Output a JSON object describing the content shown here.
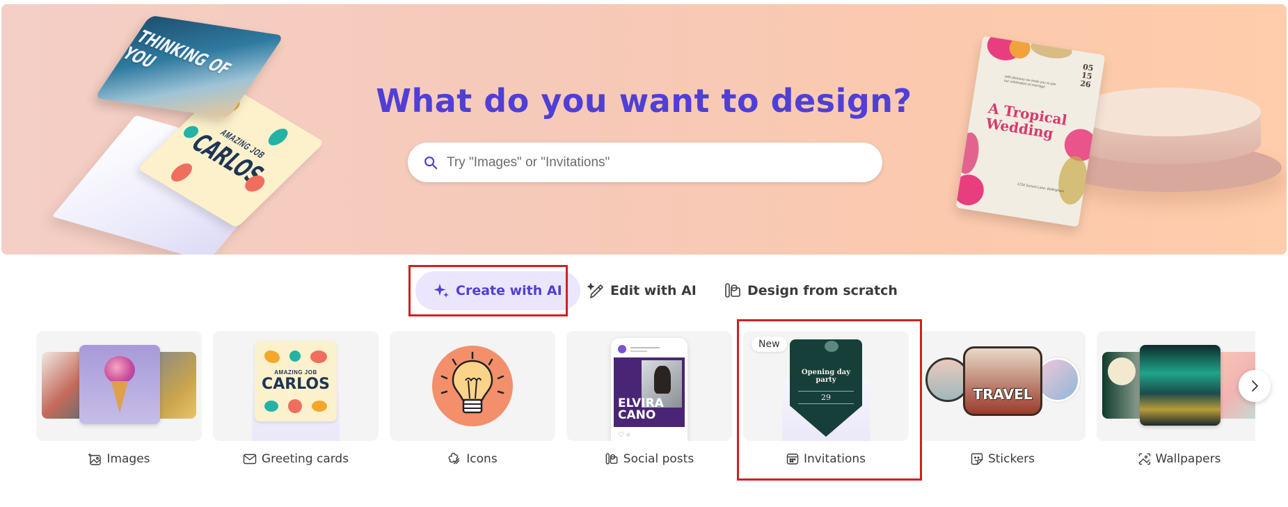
{
  "hero": {
    "title": "What do you want to design?",
    "search_placeholder": "Try \"Images\" or \"Invitations\"",
    "search_icon": "search-icon",
    "left_art": {
      "card_top_text": "THINKING OF YOU",
      "card_bottom_small": "AMAZING JOB",
      "card_bottom_big": "CARLOS"
    },
    "right_art": {
      "card_title": "A Tropical Wedding",
      "card_date": [
        "05",
        "15",
        "26"
      ]
    }
  },
  "modes": [
    {
      "label": "Create with AI",
      "icon": "sparkle-icon",
      "active": true
    },
    {
      "label": "Edit with AI",
      "icon": "magic-pen-icon",
      "active": false
    },
    {
      "label": "Design from scratch",
      "icon": "shapes-icon",
      "active": false
    }
  ],
  "categories": [
    {
      "label": "Images",
      "icon": "ai-image-icon"
    },
    {
      "label": "Greeting cards",
      "icon": "envelope-icon",
      "thumb_small": "AMAZING JOB",
      "thumb_big": "CARLOS"
    },
    {
      "label": "Icons",
      "icon": "icons-shapes-icon"
    },
    {
      "label": "Social posts",
      "icon": "social-post-icon",
      "thumb_name_1": "ELVIRA",
      "thumb_name_2": "CANO"
    },
    {
      "label": "Invitations",
      "icon": "calendar-icon",
      "badge": "New",
      "thumb_title": "Opening day party",
      "thumb_day": "29"
    },
    {
      "label": "Stickers",
      "icon": "sticker-icon",
      "thumb_text": "TRAVEL"
    },
    {
      "label": "Wallpapers",
      "icon": "wallpaper-icon"
    }
  ],
  "carousel": {
    "next_icon": "chevron-right-icon"
  },
  "colors": {
    "accent": "#4f3fd6",
    "active_tab_bg": "#ebe6fd",
    "highlight": "#d0201f",
    "hero_gradient_start": "#f4cfc6",
    "hero_gradient_end": "#ffcdab"
  }
}
